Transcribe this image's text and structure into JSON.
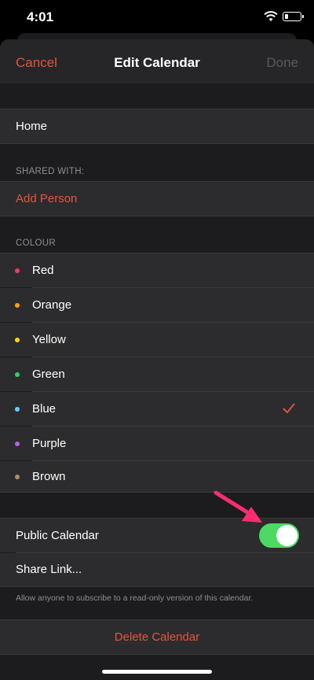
{
  "status_bar": {
    "time": "4:01",
    "battery_level": 0.25
  },
  "nav": {
    "cancel_label": "Cancel",
    "title": "Edit Calendar",
    "done_label": "Done"
  },
  "calendar_name": "Home",
  "shared_with": {
    "header": "SHARED WITH:",
    "add_person_label": "Add Person"
  },
  "colour": {
    "header": "COLOUR",
    "options": [
      {
        "label": "Red",
        "color": "#ff375f"
      },
      {
        "label": "Orange",
        "color": "#ff9f0a"
      },
      {
        "label": "Yellow",
        "color": "#ffd60a"
      },
      {
        "label": "Green",
        "color": "#30d158"
      },
      {
        "label": "Blue",
        "color": "#64d2ff"
      },
      {
        "label": "Purple",
        "color": "#bf5af2"
      },
      {
        "label": "Brown",
        "color": "#ac8e68"
      }
    ],
    "selected": "Blue"
  },
  "public_calendar": {
    "label": "Public Calendar",
    "enabled": true
  },
  "share_link": {
    "label": "Share Link..."
  },
  "footnote": "Allow anyone to subscribe to a read-only version of this calendar.",
  "delete_label": "Delete Calendar",
  "accent_color": "#e5533d",
  "annotation_arrow_color": "#ff2d6f"
}
